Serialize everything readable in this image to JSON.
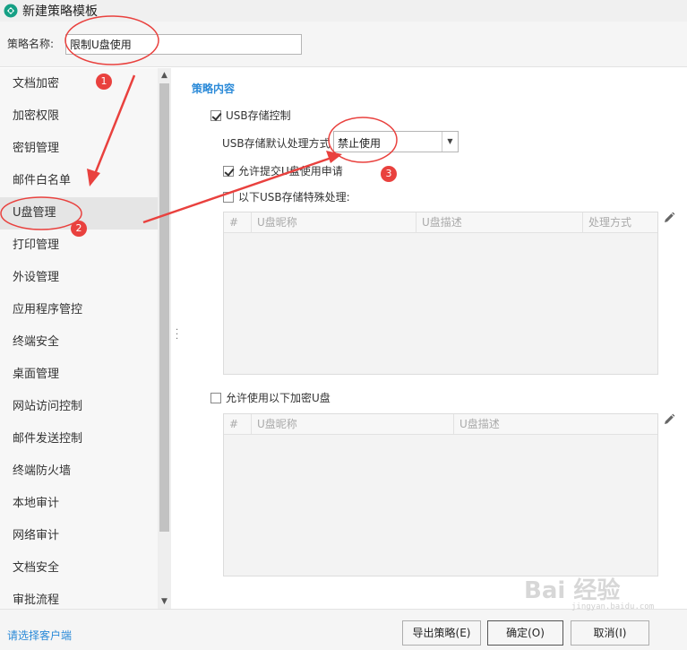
{
  "window": {
    "title": "新建策略模板"
  },
  "policy_name": {
    "label": "策略名称:",
    "value": "限制U盘使用"
  },
  "sidebar": {
    "items": [
      "文档加密",
      "加密权限",
      "密钥管理",
      "邮件白名单",
      "U盘管理",
      "打印管理",
      "外设管理",
      "应用程序管控",
      "终端安全",
      "桌面管理",
      "网站访问控制",
      "邮件发送控制",
      "终端防火墙",
      "本地审计",
      "网络审计",
      "文档安全",
      "审批流程"
    ],
    "active_index": 4
  },
  "content": {
    "section_title": "策略内容",
    "usb_control": {
      "label": "USB存储控制",
      "checked": true
    },
    "default_action": {
      "label": "USB存储默认处理方式",
      "value": "禁止使用"
    },
    "allow_request": {
      "label": "允许提交U盘使用申请",
      "checked": true
    },
    "special_handling": {
      "label": "以下USB存储特殊处理:",
      "checked": false
    },
    "grid1": {
      "columns": [
        "#",
        "U盘昵称",
        "U盘描述",
        "处理方式"
      ]
    },
    "allow_encrypted": {
      "label": "允许使用以下加密U盘",
      "checked": false
    },
    "grid2": {
      "columns": [
        "#",
        "U盘昵称",
        "U盘描述"
      ]
    }
  },
  "footer": {
    "select_client": "请选择客户端",
    "export_button": "导出策略(E)",
    "ok_button": "确定(O)",
    "cancel_button": "取消(I)"
  },
  "annotations": {
    "badge1": "1",
    "badge2": "2",
    "badge3": "3"
  },
  "watermark": {
    "text": "Bai 经验",
    "sub": "jingyan.baidu.com"
  },
  "colors": {
    "accent": "#2b8ad8",
    "annotation_red": "#e9413e"
  }
}
